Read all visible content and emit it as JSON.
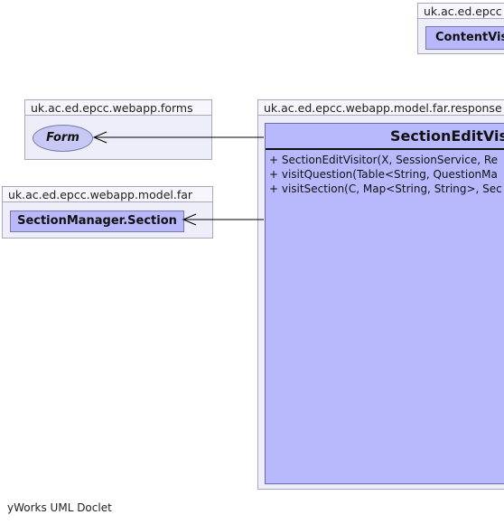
{
  "packages": {
    "content_pkg": {
      "name": "uk.ac.ed.epcc",
      "class": "ContentVis"
    },
    "forms_pkg": {
      "name": "uk.ac.ed.epcc.webapp.forms",
      "interface": "Form"
    },
    "far_pkg": {
      "name": "uk.ac.ed.epcc.webapp.model.far",
      "class": "SectionManager.Section"
    },
    "responses_pkg": {
      "name": "uk.ac.ed.epcc.webapp.model.far.response",
      "class": {
        "name": "SectionEditVis",
        "members": [
          "+ SectionEditVisitor(X, SessionService, Re",
          "+ visitQuestion(Table<String, QuestionMa",
          "+ visitSection(C, Map<String, String>, Sec"
        ]
      }
    }
  },
  "footer": "yWorks UML Doclet",
  "colors": {
    "class_fill": "#b8b8fc",
    "package_fill": "#eeeefa",
    "edge": "#000000"
  }
}
